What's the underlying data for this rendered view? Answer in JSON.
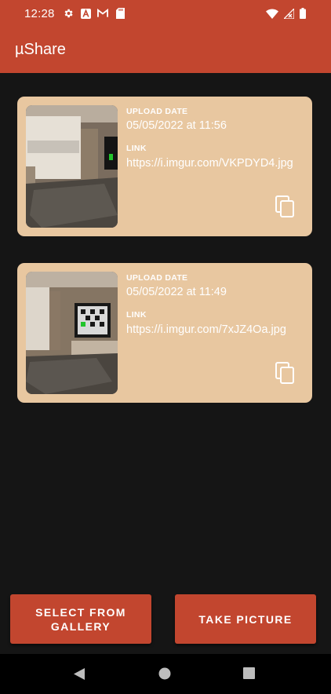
{
  "status_bar": {
    "time": "12:28",
    "left_icons": [
      "settings-icon",
      "a-badge-icon",
      "gmail-icon",
      "sd-card-icon"
    ],
    "right_icons": [
      "wifi-icon",
      "signal-icon",
      "battery-icon"
    ]
  },
  "app_bar": {
    "title": "µShare"
  },
  "uploads": [
    {
      "date_label": "UPLOAD DATE",
      "date": "05/05/2022 at 11:56",
      "link_label": "LINK",
      "link": "https://i.imgur.com/VKPDYD4.jpg",
      "thumbnail": "living-room-photo",
      "copy_icon": "copy-icon"
    },
    {
      "date_label": "UPLOAD DATE",
      "date": "05/05/2022 at 11:49",
      "link_label": "LINK",
      "link": "https://i.imgur.com/7xJZ4Oa.jpg",
      "thumbnail": "living-room-photo",
      "copy_icon": "copy-icon"
    }
  ],
  "actions": {
    "gallery_label": "Select from gallery",
    "take_picture_label": "Take picture"
  },
  "nav_bar": {
    "icons": [
      "back-icon",
      "home-icon",
      "recents-icon"
    ]
  },
  "colors": {
    "primary": "#c2462f",
    "card_background": "#e8c7a0",
    "background": "#151515",
    "navigation_bar": "#000000"
  }
}
